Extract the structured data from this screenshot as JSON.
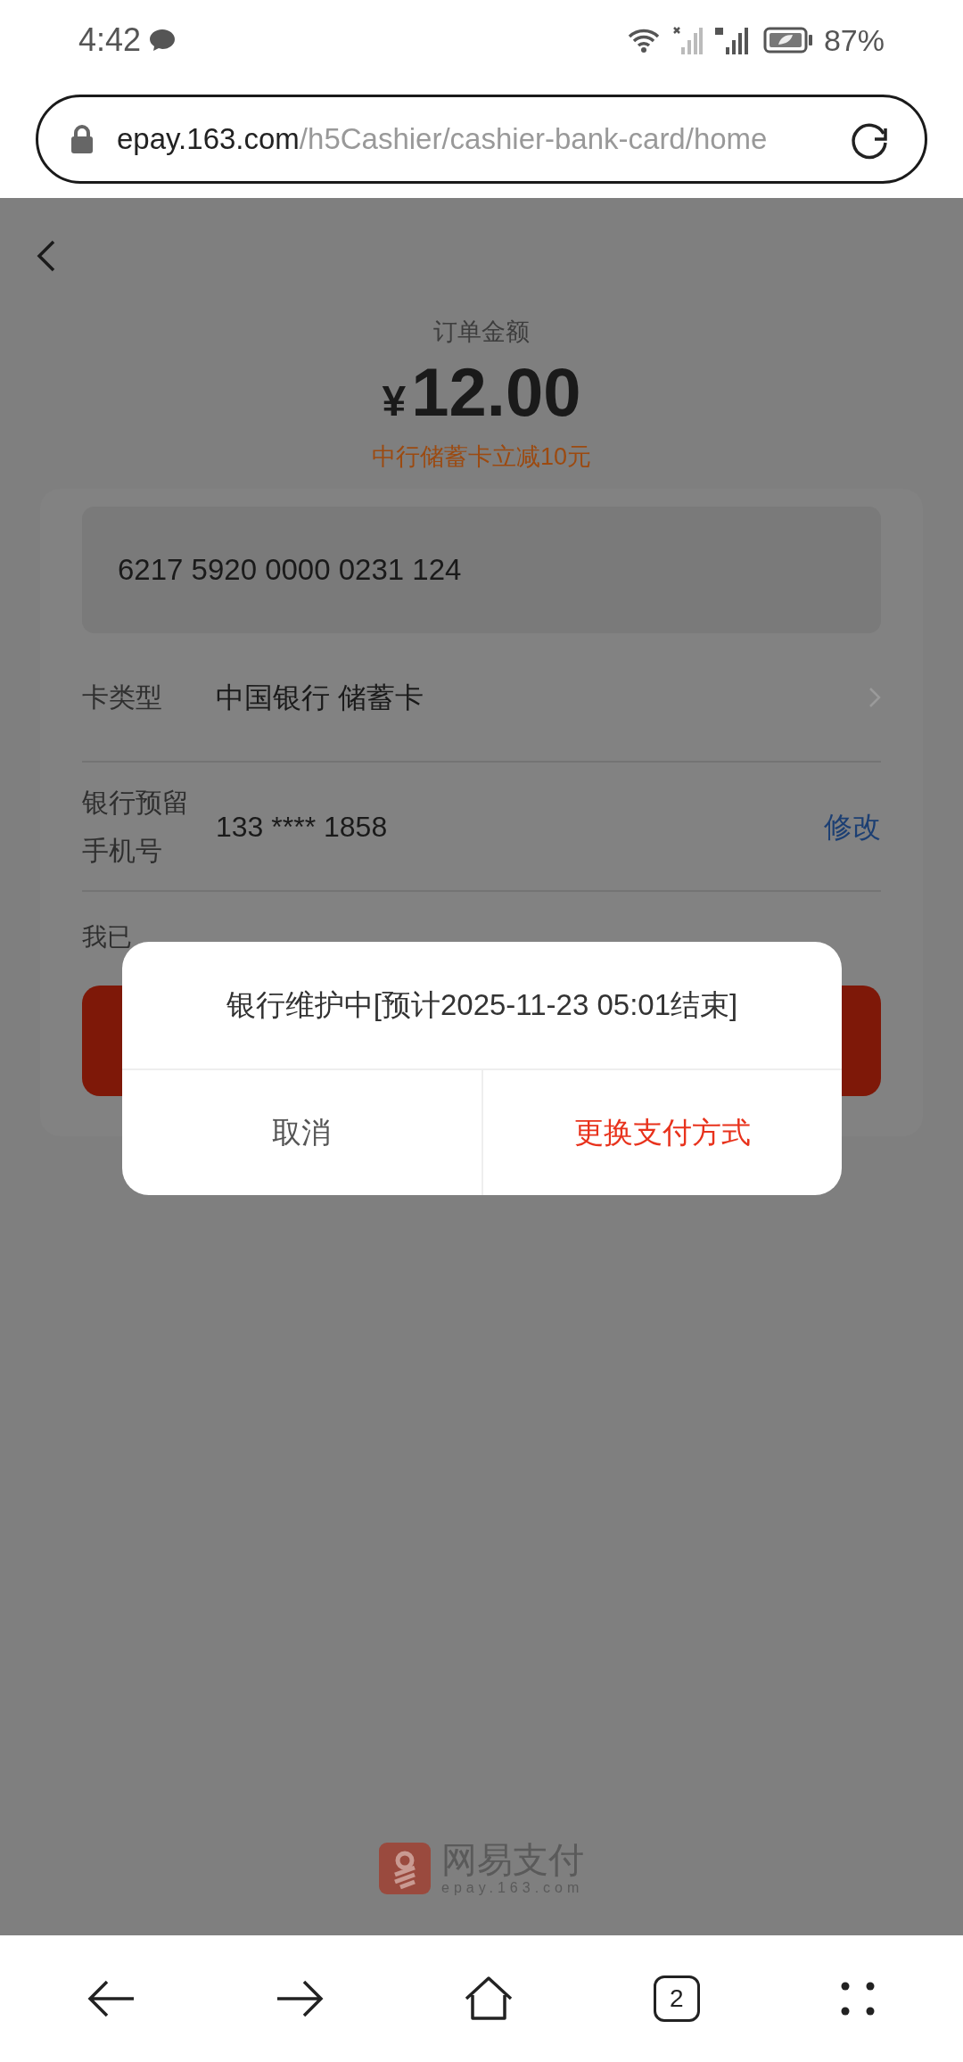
{
  "status_bar": {
    "time": "4:42",
    "battery": "87%"
  },
  "address_bar": {
    "domain": "epay.163.com",
    "path": "/h5Cashier/cashier-bank-card/home"
  },
  "order": {
    "label": "订单金额",
    "currency": "¥",
    "amount": "12.00",
    "promo": "中行储蓄卡立减10元"
  },
  "card_number": "6217 5920 0000 0231 124",
  "rows": [
    {
      "kind": "select",
      "label": "卡类型",
      "value": "中国银行 储蓄卡"
    },
    {
      "kind": "edit",
      "label": "银行预留手机号",
      "value": "133 **** 1858",
      "action": "修改"
    }
  ],
  "agreement": "我已",
  "dialog": {
    "message": "银行维护中[预计2025-11-23 05:01结束]",
    "buttons": [
      {
        "kind": "cancel",
        "label": "取消"
      },
      {
        "kind": "primary",
        "label": "更换支付方式"
      }
    ]
  },
  "footer": {
    "brand": "网易支付",
    "site": "epay.163.com"
  },
  "nav": {
    "tab_count": "2"
  }
}
